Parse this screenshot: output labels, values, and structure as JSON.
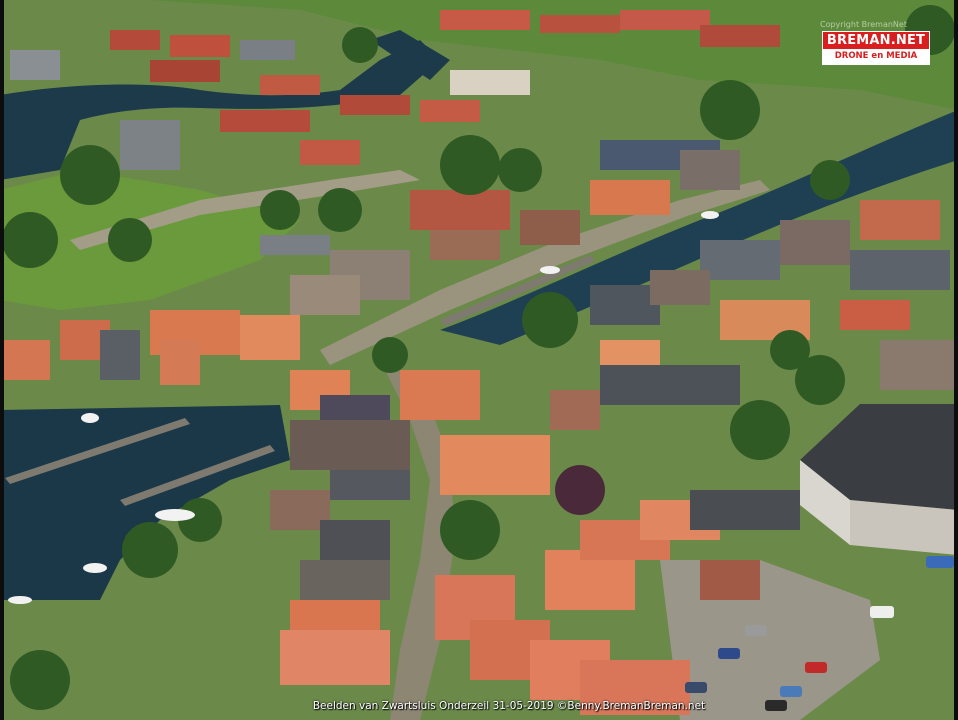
{
  "photo": {
    "description_colors": {
      "water": "#1c3b4a",
      "grass": "#5e8a3a",
      "roof_orange": "#d8794f",
      "roof_grey": "#4a4f57"
    }
  },
  "logo": {
    "brand": "BREMAN.NET",
    "tagline": "DRONE en MEDIA",
    "brand_color": "#d81e1e"
  },
  "watermark": "Copyright BremanNet",
  "caption": "Beelden van Zwartsluis Onderzeil   31-05-2019 ©Benny.BremanBreman.net"
}
